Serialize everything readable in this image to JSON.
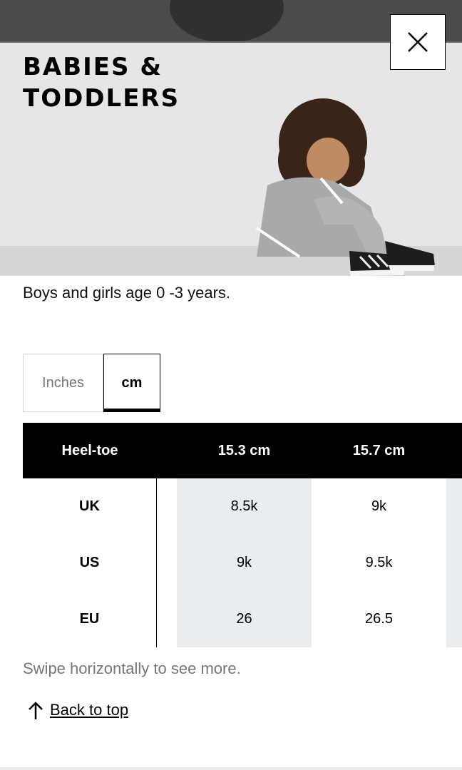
{
  "header": {
    "title": "BABIES & TODDLERS",
    "close_icon": "close-icon"
  },
  "description": "Boys and girls age 0 -3 years.",
  "unit_toggle": {
    "options": [
      "Inches",
      "cm"
    ],
    "selected": "cm"
  },
  "size_table": {
    "header": [
      "Heel-toe",
      "15.3 cm",
      "15.7 cm"
    ],
    "rows": [
      {
        "label": "UK",
        "values": [
          "8.5k",
          "9k"
        ]
      },
      {
        "label": "US",
        "values": [
          "9k",
          "9.5k"
        ]
      },
      {
        "label": "EU",
        "values": [
          "26",
          "26.5"
        ]
      }
    ]
  },
  "swipe_hint": "Swipe horizontally to see more.",
  "back_to_top": {
    "label": "Back to top",
    "icon": "arrow-up-icon"
  },
  "colors": {
    "header_bg": "#000000",
    "shaded_col": "#eaedf0",
    "hint_text": "#767677"
  }
}
